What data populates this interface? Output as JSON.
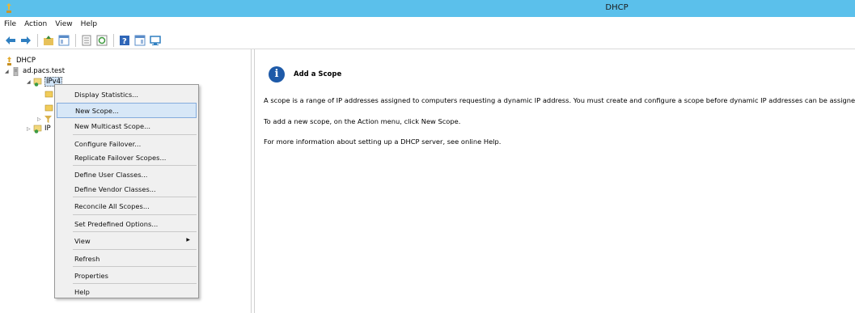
{
  "window": {
    "title": "DHCP"
  },
  "menubar": {
    "items": [
      "File",
      "Action",
      "View",
      "Help"
    ]
  },
  "toolbar": {
    "buttons": [
      "back-arrow-icon",
      "forward-arrow-icon",
      "up-folder-icon",
      "show-hide-tree-icon",
      "properties-icon",
      "refresh-icon",
      "help-icon",
      "show-hide-action-pane-icon",
      "monitor-icon"
    ]
  },
  "tree": {
    "root": "DHCP",
    "server": "ad.pacs.test",
    "ipv4": "IPv4",
    "ipv6": "IP"
  },
  "context_menu": {
    "items": [
      "Display Statistics...",
      "New Scope...",
      "New Multicast Scope...",
      "Configure Failover...",
      "Replicate Failover Scopes...",
      "Define User Classes...",
      "Define Vendor Classes...",
      "Reconcile All Scopes...",
      "Set Predefined Options...",
      "View",
      "Refresh",
      "Properties",
      "Help"
    ],
    "highlighted": "New Scope..."
  },
  "details": {
    "heading": "Add a Scope",
    "paragraphs": [
      "A scope is a range of IP addresses assigned to computers requesting a dynamic IP address. You must create and configure a scope before dynamic IP addresses can be assigned",
      "To add a new scope, on the Action menu, click New Scope.",
      "For more information about setting up a DHCP server, see online Help."
    ]
  },
  "colors": {
    "titlebar": "#5bc0eb",
    "highlight": "#d7e7f7",
    "info_icon": "#1e5aa8"
  }
}
